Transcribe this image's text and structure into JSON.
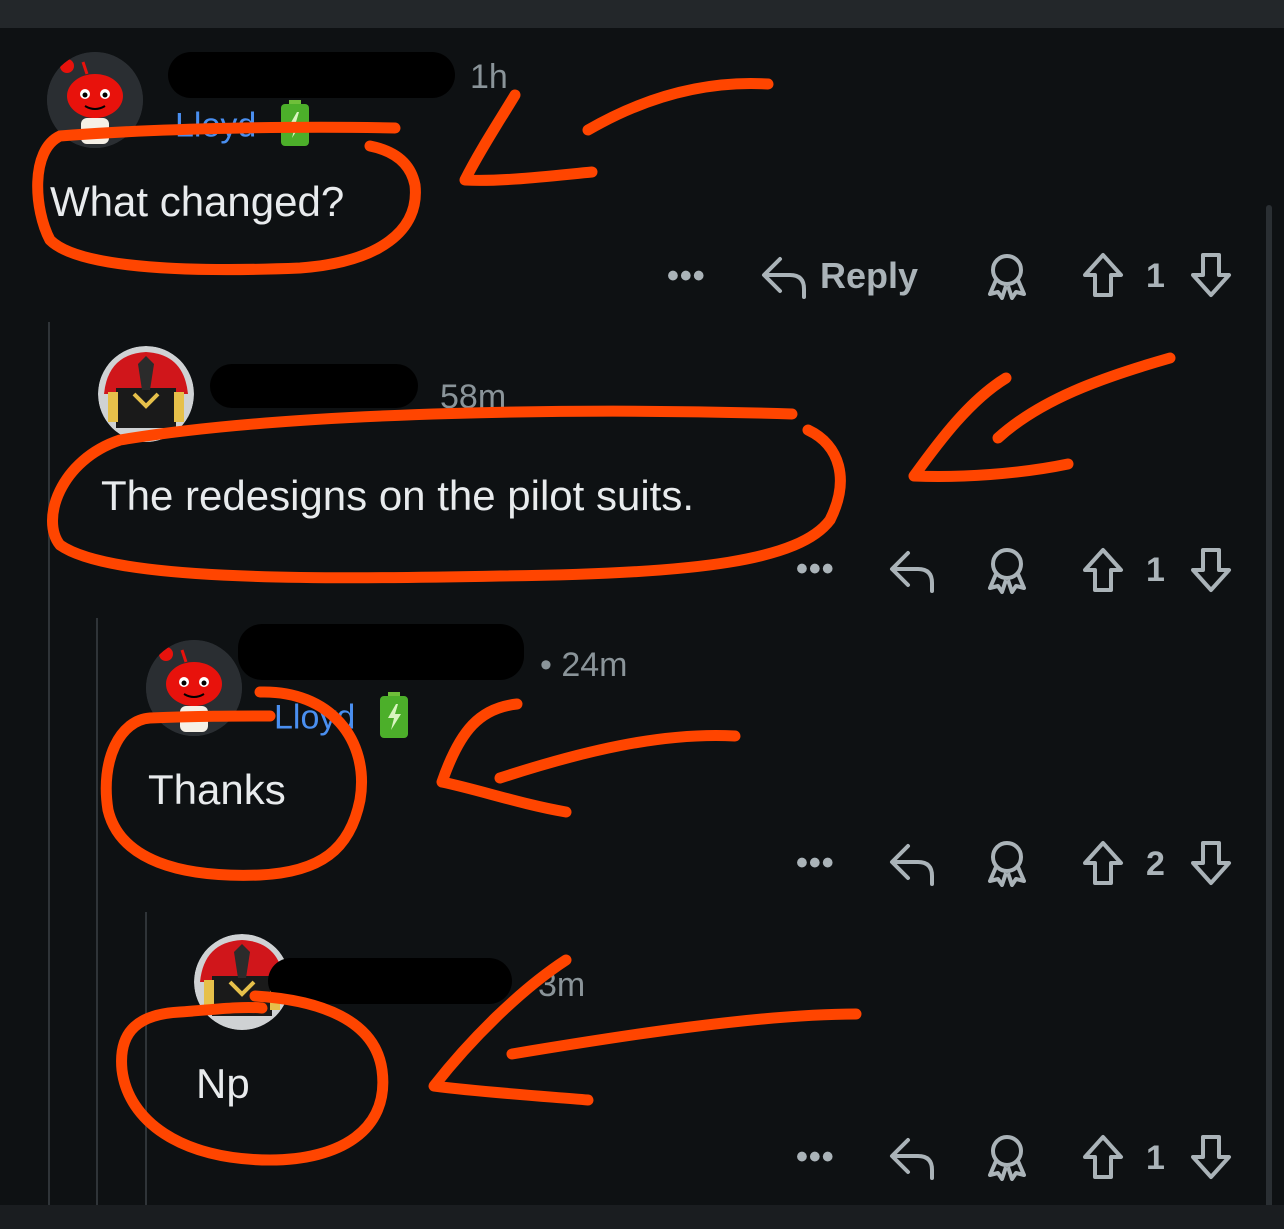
{
  "comments": [
    {
      "time": "1h",
      "flair": "Lloyd",
      "text": "What changed?",
      "reply_label": "Reply",
      "score": "1"
    },
    {
      "time": "58m",
      "text": "The redesigns on the pilot suits.",
      "score": "1"
    },
    {
      "time": "• 24m",
      "flair": "Lloyd",
      "text": "Thanks",
      "score": "2"
    },
    {
      "time": "3m",
      "text": "Np",
      "score": "1"
    }
  ],
  "more_label": "•••",
  "icons": [
    "snoo-avatar-icon",
    "helmet-avatar-icon",
    "battery-flair-icon",
    "more-options-icon",
    "reply-icon",
    "award-icon",
    "upvote-icon",
    "downvote-icon"
  ],
  "colors": {
    "background": "#0e1113",
    "annotation": "#ff4500",
    "flair": "#4a8ff0",
    "meta": "#8a9499"
  }
}
